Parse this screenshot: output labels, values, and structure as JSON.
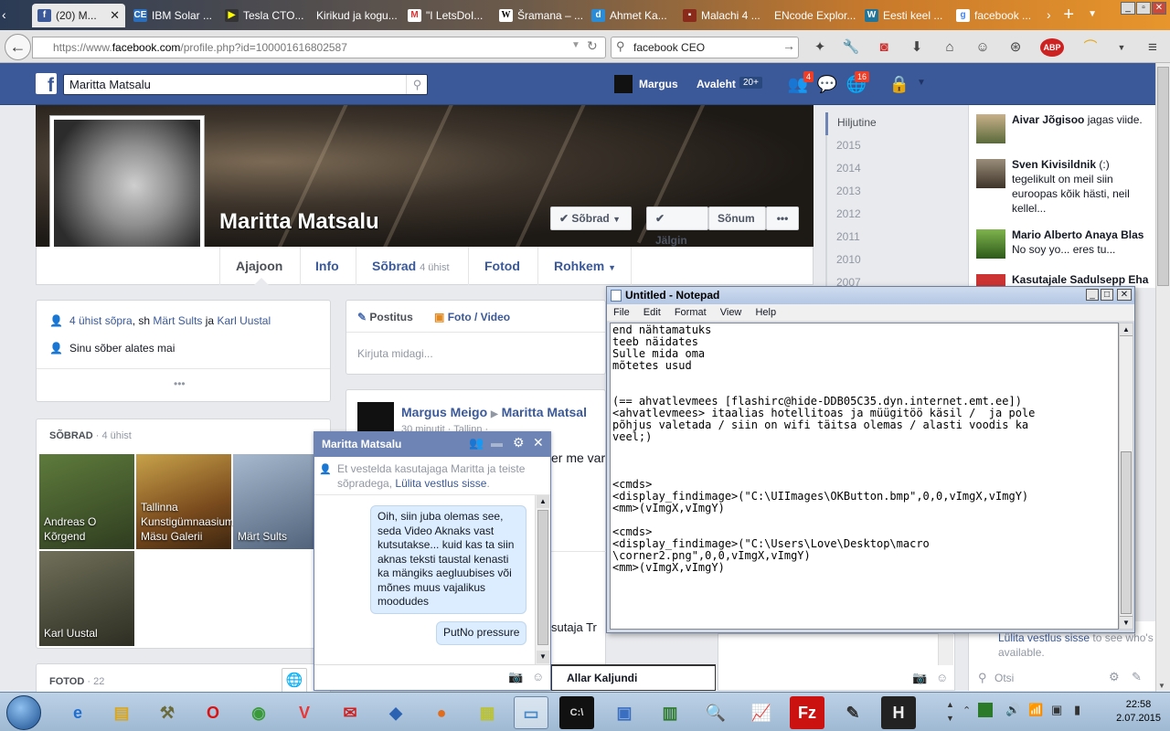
{
  "browser": {
    "tabs": [
      {
        "label": "(20) M...",
        "icon": "facebook-icon",
        "active": true
      },
      {
        "label": "IBM Solar ...",
        "icon": "ce-icon"
      },
      {
        "label": "Tesla CTO...",
        "icon": "video-icon"
      },
      {
        "label": "Kirikud ja kogu...",
        "icon": "page-icon"
      },
      {
        "label": "\"I LetsDoI...",
        "icon": "gmail-icon"
      },
      {
        "label": "Šramana – ...",
        "icon": "wikipedia-icon"
      },
      {
        "label": "Ahmet Ka...",
        "icon": "d-icon"
      },
      {
        "label": "Malachi 4 ...",
        "icon": "page-icon"
      },
      {
        "label": "ENcode Explor...",
        "icon": "page-icon"
      },
      {
        "label": "Eesti keel ...",
        "icon": "wordpress-icon"
      },
      {
        "label": "facebook ...",
        "icon": "google-icon"
      }
    ],
    "url_prefix": "https://www.",
    "url_domain": "facebook.com",
    "url_rest": "/profile.php?id=100001616802587",
    "search_value": "facebook CEO"
  },
  "fb": {
    "search_value": "Maritta Matsalu",
    "user_name": "Margus",
    "home_label": "Avaleht",
    "home_count": "20+",
    "friend_requests_count": "4",
    "notifications_count": "16"
  },
  "profile": {
    "name": "Maritta Matsalu",
    "btn_friends": "Sõbrad",
    "btn_follow": "Jälgin",
    "btn_message": "Sõnum",
    "btn_more": "•••",
    "tabs": {
      "timeline": "Ajajoon",
      "about": "Info",
      "friends": "Sõbrad",
      "friends_count": "4 ühist",
      "photos": "Fotod",
      "more": "Rohkem"
    },
    "intro": {
      "mutual_link": "4 ühist sõpra",
      "mutual_mid": ", sh ",
      "mutual_f1": "Märt Sults",
      "mutual_and": " ja ",
      "mutual_f2": "Karl Uustal",
      "since": "Sinu sõber alates mai",
      "dots": "•••"
    },
    "friends_header": "SÕBRAD",
    "friends_header_count": "· 4 ühist",
    "friends": [
      {
        "name": "Andreas O Kõrgend"
      },
      {
        "name": "Tallinna Kunstigümnaasiumi Mäsu Galerii"
      },
      {
        "name": "Märt Sults"
      },
      {
        "name": "Karl Uustal"
      }
    ],
    "photos_header": "FOTOD",
    "photos_count": "· 22",
    "composer_status": "Postitus",
    "composer_photo": "Foto / Video",
    "composer_placeholder": "Kirjuta midagi...",
    "post_author": "Margus Meigo",
    "post_target": "Maritta Matsal",
    "post_meta": "30 minutit · Tallinn ·",
    "post_text_fragment": "er me var",
    "post_footer_fragment": "sutaja Tr"
  },
  "timeline_years": [
    "Hiljutine",
    "2015",
    "2014",
    "2013",
    "2012",
    "2011",
    "2010",
    "2007"
  ],
  "ticker": [
    {
      "name": "Aivar Jõgisoo",
      "text": " jagas viide."
    },
    {
      "name": "Sven Kivisildnik",
      "text": " (:) tegelikult on meil siin euroopas kõik hästi, neil kellel..."
    },
    {
      "name": "Mario Alberto Anaya Blas",
      "text": " No soy yo... eres tu..."
    },
    {
      "name": "Kasutajale Sadulsepp Eha",
      "text": ""
    }
  ],
  "chat_sidebar": {
    "turn_on_link": "Lülita vestlus sisse",
    "turn_on_rest": " to see who's available.",
    "search_placeholder": "Otsi"
  },
  "chat": {
    "title": "Maritta Matsalu",
    "notice_prefix": "Et vestelda kasutajaga Maritta ja teiste sõpradega, ",
    "notice_link": "Lülita vestlus sisse",
    "notice_suffix": ".",
    "messages": [
      "Oih, siin juba olemas see, seda Video Aknaks vast kutsutakse... kuid kas ta siin aknas teksti taustal kenasti ka mängiks aegluubises või mõnes muus vajalikus moodudes",
      "PutNo pressure"
    ]
  },
  "chat2": {
    "title": "Allar Kaljundi"
  },
  "notepad": {
    "title": "Untitled - Notepad",
    "menu": [
      "File",
      "Edit",
      "Format",
      "View",
      "Help"
    ],
    "content": "end nähtamatuks\nteeb näidates\nSulle mida oma\nmõtetes usud\n\n\n(== ahvatlevmees [flashirc@hide-DDB05C35.dyn.internet.emt.ee])\n<ahvatlevmees> itaalias hotellitoas ja müügitöö käsil /  ja pole\npõhjus valetada / siin on wifi täitsa olemas / alasti voodis ka\nveel;)\n\n\n\n<cmds>\n<display_findimage>(\"C:\\UIImages\\OKButton.bmp\",0,0,vImgX,vImgY)\n<mm>(vImgX,vImgY)\n\n<cmds>\n<display_findimage>(\"C:\\Users\\Love\\Desktop\\macro\n\\corner2.png\",0,0,vImgX,vImgY)\n<mm>(vImgX,vImgY)"
  },
  "taskbar": {
    "time": "22:58",
    "date": "2.07.2015"
  },
  "colors": {
    "fb_blue": "#3b5998",
    "chat_header": "#6d84b4",
    "bubble": "#dbedfe",
    "badge_red": "#f03d25"
  }
}
